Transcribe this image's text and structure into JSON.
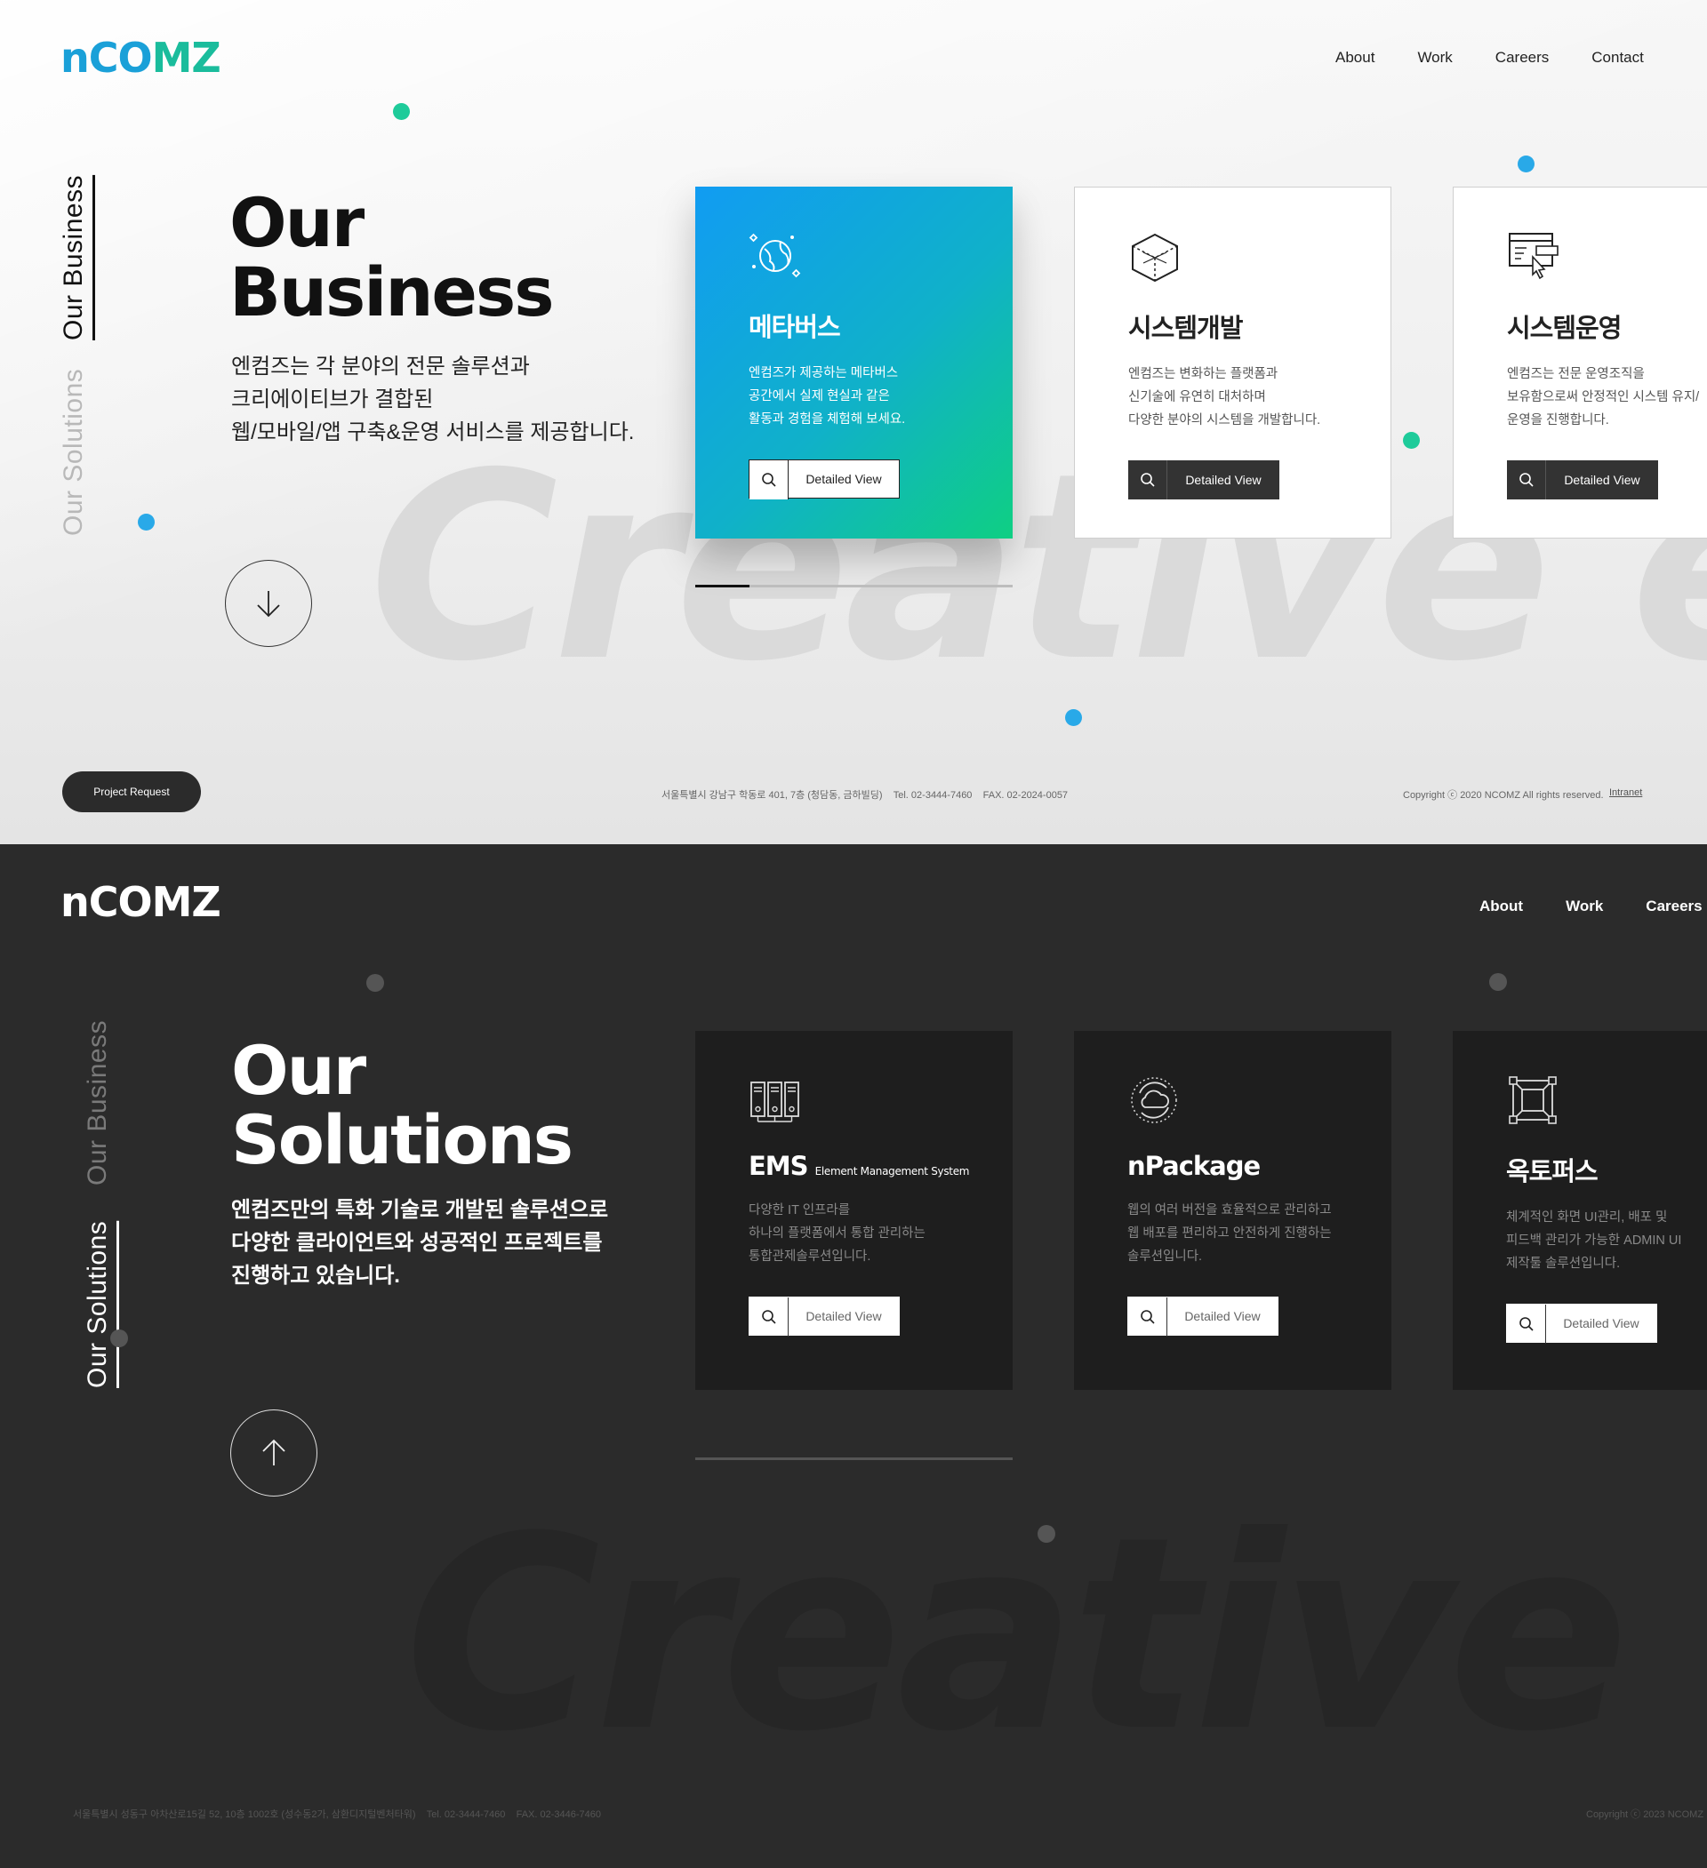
{
  "colors": {
    "accent_blue": "#1aa0d8",
    "accent_green": "#1abc9c",
    "dark_bg": "#2b2b2b",
    "card_dark": "#1e1e1e"
  },
  "business": {
    "logo": {
      "part1": "nCO",
      "part2": "MZ"
    },
    "nav": [
      "About",
      "Work",
      "Careers",
      "Contact"
    ],
    "side_tabs": {
      "active": "Our Business",
      "inactive": "Our Solutions"
    },
    "title_line1": "Our",
    "title_line2": "Business",
    "desc_lines": [
      "엔컴즈는 각 분야의 전문 솔루션과",
      "크리에이티브가 결합된",
      "웹/모바일/앱 구축&운영 서비스를 제공합니다."
    ],
    "bg_word": "Creative e-B",
    "scroll_icon": "arrow-down-icon",
    "cards": [
      {
        "title": "메타버스",
        "lines": [
          "엔컴즈가 제공하는 메타버스",
          "공간에서 실제 현실과 같은",
          "활동과 경험을 체험해 보세요."
        ],
        "button": "Detailed View",
        "icon": "globe-icon"
      },
      {
        "title": "시스템개발",
        "lines": [
          "엔컴즈는 변화하는 플랫폼과",
          "신기술에 유연히 대처하며",
          "다양한 분야의 시스템을 개발합니다."
        ],
        "button": "Detailed View",
        "icon": "cube-icon"
      },
      {
        "title": "시스템운영",
        "lines": [
          "엔컴즈는 전문 운영조직을",
          "보유함으로써 안정적인 시스템 유지/",
          "운영을 진행합니다."
        ],
        "button": "Detailed View",
        "icon": "window-cursor-icon"
      }
    ],
    "progress": 0.17,
    "project_request": "Project Request",
    "address": "서울특별시 강남구 학동로 401, 7층 (청담동, 금하빌딩)    Tel. 02-3444-7460    FAX. 02-2024-0057",
    "copyright": "Copyright ⓒ 2020 NCOMZ All rights reserved.",
    "intranet": "Intranet"
  },
  "solutions": {
    "logo": "nCOMZ",
    "nav": [
      "About",
      "Work",
      "Careers"
    ],
    "side_tabs": {
      "inactive": "Our Business",
      "active": "Our Solutions"
    },
    "title_line1": "Our",
    "title_line2": "Solutions",
    "desc_lines": [
      "엔컴즈만의 특화 기술로 개발된 솔루션으로",
      "다양한 클라이언트와 성공적인 프로젝트를",
      "진행하고 있습니다."
    ],
    "bg_word": "Creative e-",
    "scroll_icon": "arrow-up-icon",
    "cards": [
      {
        "title": "EMS",
        "subtitle": "Element Management System",
        "lines": [
          "다양한 IT 인프라를",
          "하나의 플랫폼에서 통합 관리하는",
          "통합관제솔루션입니다."
        ],
        "button": "Detailed View",
        "icon": "server-rack-icon"
      },
      {
        "title": "nPackage",
        "subtitle": "",
        "lines": [
          "웹의 여러 버전을 효율적으로 관리하고",
          "웹 배포를 편리하고 안전하게 진행하는",
          "솔루션입니다."
        ],
        "button": "Detailed View",
        "icon": "cloud-sync-icon"
      },
      {
        "title": "옥토퍼스",
        "subtitle": "",
        "lines": [
          "체계적인 화면 UI관리, 배포 및",
          "피드백 관리가 가능한 ADMIN UI",
          "제작툴 솔루션입니다."
        ],
        "button": "Detailed View",
        "icon": "frame-icon"
      }
    ],
    "address": "서울특별시 성동구 아차산로15길 52, 10층 1002호 (성수동2가, 삼환디지털벤처타워)    Tel. 02-3444-7460    FAX. 02-3446-7460",
    "copyright": "Copyright ⓒ 2023 NCOMZ"
  }
}
